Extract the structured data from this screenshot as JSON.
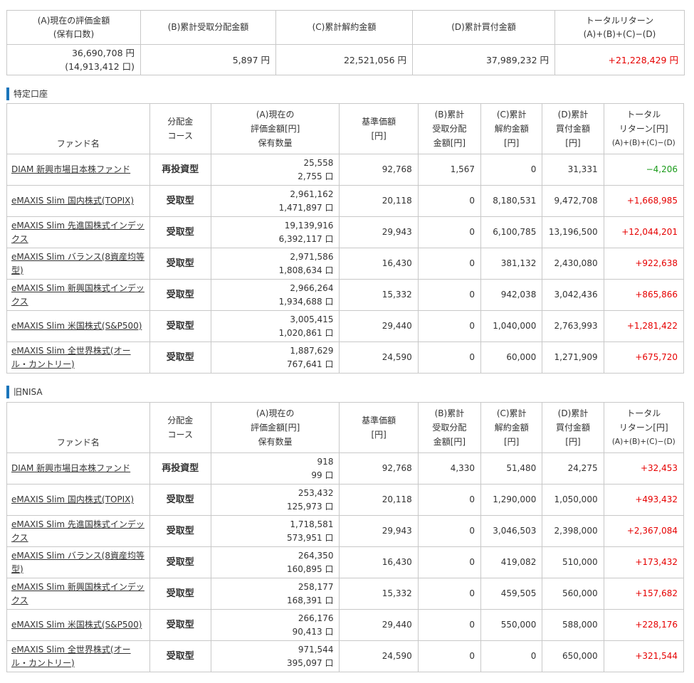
{
  "summary": {
    "headers": [
      "(A)現在の評価金額\n(保有口数)",
      "(B)累計受取分配金額",
      "(C)累計解約金額",
      "(D)累計買付金額",
      "トータルリターン\n(A)+(B)+(C)−(D)"
    ],
    "a_value": "36,690,708 円",
    "a_units": "(14,913,412 口)",
    "b": "5,897 円",
    "c": "22,521,056 円",
    "d": "37,989,232 円",
    "total": "+21,228,429 円"
  },
  "columns": {
    "name": "ファンド名",
    "course": "分配金\nコース",
    "a": "(A)現在の\n評価金額[円]\n保有数量",
    "base": "基準価額\n[円]",
    "b": "(B)累計\n受取分配\n金額[円]",
    "c": "(C)累計\n解約金額\n[円]",
    "d": "(D)累計\n買付金額\n[円]",
    "ret": "トータル\nリターン[円]",
    "ret_formula": "(A)+(B)+(C)−(D)"
  },
  "sections": [
    {
      "title": "特定口座",
      "rows": [
        {
          "name": "DIAM 新興市場日本株ファンド",
          "course": "再投資型",
          "value": "25,558",
          "units": "2,755 口",
          "base": "92,768",
          "b": "1,567",
          "c": "0",
          "d": "31,331",
          "ret": "−4,206",
          "sign": "neg"
        },
        {
          "name": "eMAXIS Slim 国内株式(TOPIX)",
          "course": "受取型",
          "value": "2,961,162",
          "units": "1,471,897 口",
          "base": "20,118",
          "b": "0",
          "c": "8,180,531",
          "d": "9,472,708",
          "ret": "+1,668,985",
          "sign": "pos"
        },
        {
          "name": "eMAXIS Slim 先進国株式インデックス",
          "course": "受取型",
          "value": "19,139,916",
          "units": "6,392,117 口",
          "base": "29,943",
          "b": "0",
          "c": "6,100,785",
          "d": "13,196,500",
          "ret": "+12,044,201",
          "sign": "pos"
        },
        {
          "name": "eMAXIS Slim バランス(8資産均等型)",
          "course": "受取型",
          "value": "2,971,586",
          "units": "1,808,634 口",
          "base": "16,430",
          "b": "0",
          "c": "381,132",
          "d": "2,430,080",
          "ret": "+922,638",
          "sign": "pos"
        },
        {
          "name": "eMAXIS Slim 新興国株式インデックス",
          "course": "受取型",
          "value": "2,966,264",
          "units": "1,934,688 口",
          "base": "15,332",
          "b": "0",
          "c": "942,038",
          "d": "3,042,436",
          "ret": "+865,866",
          "sign": "pos"
        },
        {
          "name": "eMAXIS Slim 米国株式(S&P500)",
          "course": "受取型",
          "value": "3,005,415",
          "units": "1,020,861 口",
          "base": "29,440",
          "b": "0",
          "c": "1,040,000",
          "d": "2,763,993",
          "ret": "+1,281,422",
          "sign": "pos"
        },
        {
          "name": "eMAXIS Slim 全世界株式(オール・カントリー)",
          "course": "受取型",
          "value": "1,887,629",
          "units": "767,641 口",
          "base": "24,590",
          "b": "0",
          "c": "60,000",
          "d": "1,271,909",
          "ret": "+675,720",
          "sign": "pos"
        }
      ]
    },
    {
      "title": "旧NISA",
      "rows": [
        {
          "name": "DIAM 新興市場日本株ファンド",
          "course": "再投資型",
          "value": "918",
          "units": "99 口",
          "base": "92,768",
          "b": "4,330",
          "c": "51,480",
          "d": "24,275",
          "ret": "+32,453",
          "sign": "pos"
        },
        {
          "name": "eMAXIS Slim 国内株式(TOPIX)",
          "course": "受取型",
          "value": "253,432",
          "units": "125,973 口",
          "base": "20,118",
          "b": "0",
          "c": "1,290,000",
          "d": "1,050,000",
          "ret": "+493,432",
          "sign": "pos"
        },
        {
          "name": "eMAXIS Slim 先進国株式インデックス",
          "course": "受取型",
          "value": "1,718,581",
          "units": "573,951 口",
          "base": "29,943",
          "b": "0",
          "c": "3,046,503",
          "d": "2,398,000",
          "ret": "+2,367,084",
          "sign": "pos"
        },
        {
          "name": "eMAXIS Slim バランス(8資産均等型)",
          "course": "受取型",
          "value": "264,350",
          "units": "160,895 口",
          "base": "16,430",
          "b": "0",
          "c": "419,082",
          "d": "510,000",
          "ret": "+173,432",
          "sign": "pos"
        },
        {
          "name": "eMAXIS Slim 新興国株式インデックス",
          "course": "受取型",
          "value": "258,177",
          "units": "168,391 口",
          "base": "15,332",
          "b": "0",
          "c": "459,505",
          "d": "560,000",
          "ret": "+157,682",
          "sign": "pos"
        },
        {
          "name": "eMAXIS Slim 米国株式(S&P500)",
          "course": "受取型",
          "value": "266,176",
          "units": "90,413 口",
          "base": "29,440",
          "b": "0",
          "c": "550,000",
          "d": "588,000",
          "ret": "+228,176",
          "sign": "pos"
        },
        {
          "name": "eMAXIS Slim 全世界株式(オール・カントリー)",
          "course": "受取型",
          "value": "971,544",
          "units": "395,097 口",
          "base": "24,590",
          "b": "0",
          "c": "0",
          "d": "650,000",
          "ret": "+321,544",
          "sign": "pos"
        }
      ]
    }
  ]
}
